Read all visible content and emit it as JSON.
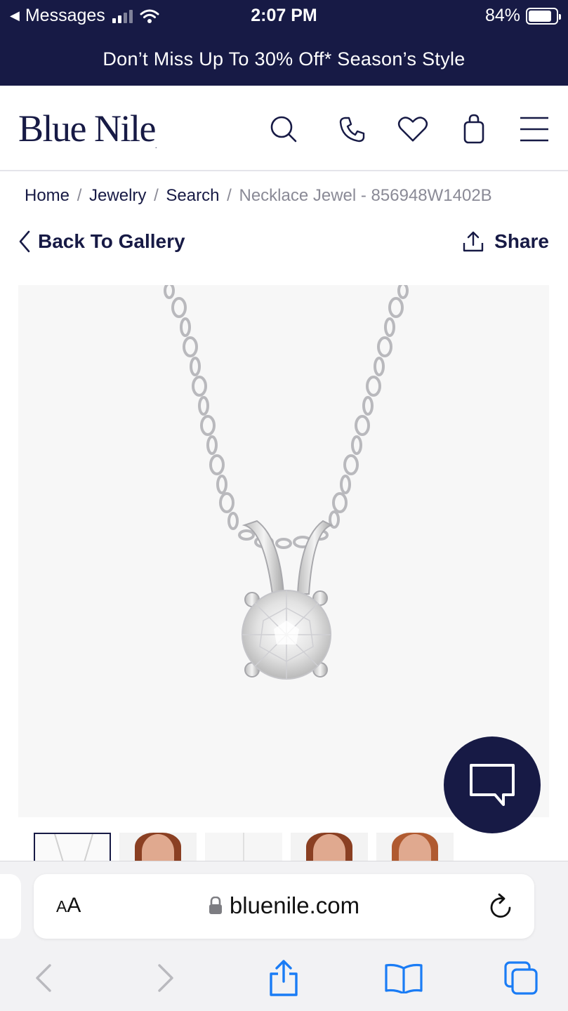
{
  "status_bar": {
    "back_app": "Messages",
    "time": "2:07 PM",
    "battery": "84%",
    "battery_level": 0.84
  },
  "promo": {
    "text": "Don’t Miss Up To 30% Off* Season’s Style"
  },
  "header": {
    "logo": "Blue Nile",
    "icons": [
      "search-icon",
      "phone-icon",
      "heart-icon",
      "shopping-bag-icon",
      "menu-icon"
    ]
  },
  "breadcrumb": {
    "items": [
      "Home",
      "Jewelry",
      "Search"
    ],
    "current": "Necklace Jewel - 856948W1402B",
    "separator": "/"
  },
  "actions": {
    "back_label": "Back To Gallery",
    "share_label": "Share"
  },
  "product": {
    "image": "necklace-pendant-image",
    "thumbnail_count": 5
  },
  "browser": {
    "aa_label_small": "A",
    "aa_label_large": "A",
    "url": "bluenile.com"
  },
  "colors": {
    "brand_navy": "#171a45",
    "ios_blue": "#1a7cf5"
  }
}
